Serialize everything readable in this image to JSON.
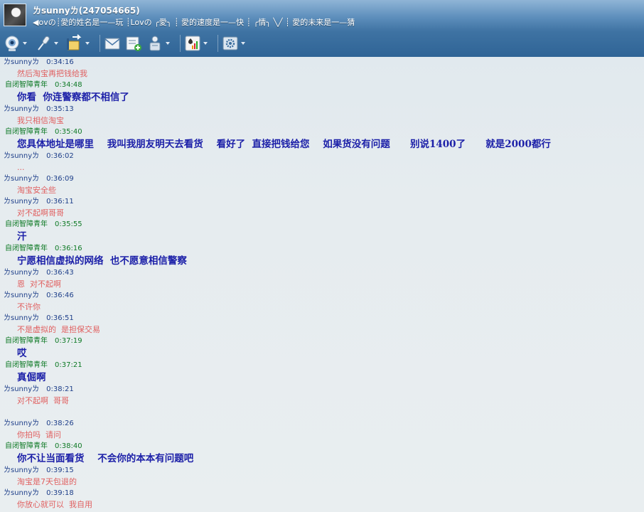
{
  "window": {
    "nickname": "ㄌsunnyㄌ(247054665)",
    "signature": "◀ovの┊愛的姓名是一—玩  ┊Lovの  ╭愛╮  ┊ 愛的速度是一—快  ┊ ╭情╮  ╲╱  ┊ 愛的未来是一—猜"
  },
  "toolbar": {
    "items": [
      {
        "name": "video-call",
        "icon": "camera-icon"
      },
      {
        "name": "voice-call",
        "icon": "microphone-icon"
      },
      {
        "name": "send-file",
        "icon": "file-transfer-icon"
      },
      {
        "name": "send-mail",
        "icon": "mail-icon"
      },
      {
        "name": "create-group",
        "icon": "add-group-icon"
      },
      {
        "name": "remote-assist",
        "icon": "remote-assistance-icon"
      },
      {
        "name": "apps",
        "icon": "apps-icon"
      },
      {
        "name": "settings",
        "icon": "settings-icon"
      }
    ]
  },
  "colors": {
    "self_name": "#0f7a26",
    "other_name": "#1e3f8a",
    "self_text": "#1b1fa8",
    "other_text": "#e06060"
  },
  "messages": [
    {
      "sender": "ㄌsunnyㄌ",
      "time": "0:34:16",
      "text": "然后淘宝再把钱给我",
      "self": false
    },
    {
      "sender": "自闭智障青年",
      "time": "0:34:48",
      "text": "你看  你连警察都不相信了",
      "self": true
    },
    {
      "sender": "ㄌsunnyㄌ",
      "time": "0:35:13",
      "text": "我只相信淘宝",
      "self": false
    },
    {
      "sender": "自闭智障青年",
      "time": "0:35:40",
      "text": "您具体地址是哪里    我叫我朋友明天去看货    看好了  直接把钱给您    如果货没有问题      别说1400了      就是2000都行",
      "self": true
    },
    {
      "sender": "ㄌsunnyㄌ",
      "time": "0:36:02",
      "text": "...",
      "self": false
    },
    {
      "sender": "ㄌsunnyㄌ",
      "time": "0:36:09",
      "text": "淘宝安全些",
      "self": false
    },
    {
      "sender": "ㄌsunnyㄌ",
      "time": "0:36:11",
      "text": "对不起啊哥哥",
      "self": false
    },
    {
      "sender": "自闭智障青年",
      "time": "0:35:55",
      "text": "汗",
      "self": true
    },
    {
      "sender": "自闭智障青年",
      "time": "0:36:16",
      "text": "宁愿相信虚拟的网络  也不愿意相信警察",
      "self": true
    },
    {
      "sender": "ㄌsunnyㄌ",
      "time": "0:36:43",
      "text": "恩  对不起啊",
      "self": false
    },
    {
      "sender": "ㄌsunnyㄌ",
      "time": "0:36:46",
      "text": "不许你",
      "self": false
    },
    {
      "sender": "ㄌsunnyㄌ",
      "time": "0:36:51",
      "text": "不是虚拟的  是担保交易",
      "self": false
    },
    {
      "sender": "自闭智障青年",
      "time": "0:37:19",
      "text": "哎",
      "self": true
    },
    {
      "sender": "自闭智障青年",
      "time": "0:37:21",
      "text": "真倔啊",
      "self": true
    },
    {
      "sender": "ㄌsunnyㄌ",
      "time": "0:38:21",
      "text": "对不起啊  哥哥",
      "self": false,
      "gap_after": true
    },
    {
      "sender": "ㄌsunnyㄌ",
      "time": "0:38:26",
      "text": "你拍吗  请问",
      "self": false
    },
    {
      "sender": "自闭智障青年",
      "time": "0:38:40",
      "text": "你不让当面看货    不会你的本本有问题吧",
      "self": true
    },
    {
      "sender": "ㄌsunnyㄌ",
      "time": "0:39:15",
      "text": "淘宝是7天包退的",
      "self": false
    },
    {
      "sender": "ㄌsunnyㄌ",
      "time": "0:39:18",
      "text": "你放心就可以  我自用",
      "self": false
    }
  ]
}
